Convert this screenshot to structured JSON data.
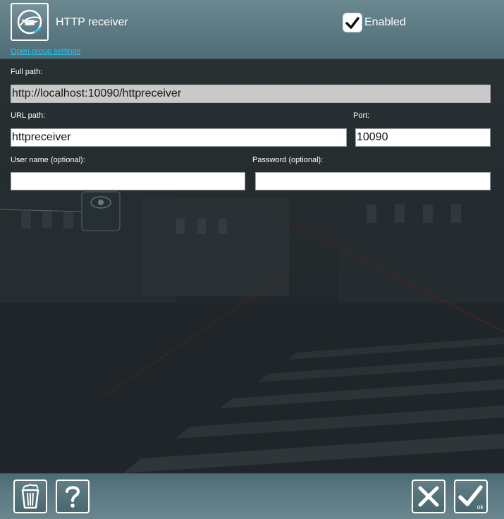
{
  "header": {
    "title": "HTTP receiver",
    "app_icon": "http-receiver-icon",
    "group_settings_link": "Open group settings",
    "enabled_label": "Enabled",
    "enabled_checked": true
  },
  "form": {
    "full_path": {
      "label": "Full path:",
      "value": "http://localhost:10090/httpreceiver"
    },
    "url_path": {
      "label": "URL path:",
      "value": "httpreceiver"
    },
    "port": {
      "label": "Port:",
      "value": "10090"
    },
    "username": {
      "label": "User name (optional):",
      "value": ""
    },
    "password": {
      "label": "Password (optional):",
      "value": ""
    }
  },
  "footer": {
    "delete_icon": "trash-icon",
    "help_icon": "question-icon",
    "cancel_icon": "close-icon",
    "ok_icon": "checkmark-icon",
    "ok_label": "ok"
  },
  "colors": {
    "bar": "#5b7982",
    "link": "#22c8f0",
    "field_readonly": "#c9c9c9"
  }
}
